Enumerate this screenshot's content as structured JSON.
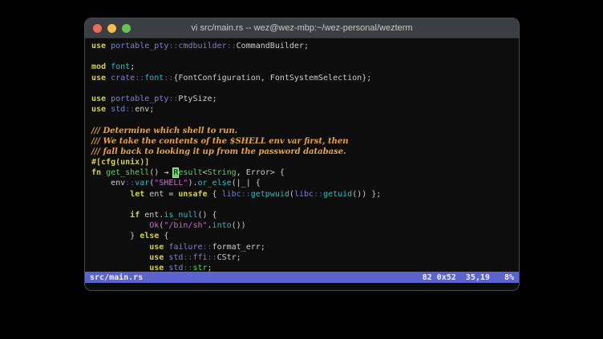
{
  "window": {
    "title": "vi src/main.rs -- wez@wez-mbp:~/wez-personal/wezterm",
    "traffic_lights": [
      "close",
      "minimize",
      "zoom"
    ]
  },
  "palette": {
    "terminal_background": "#0d0d0d",
    "titlebar_background": "#3b3e43",
    "keyword_yellow": "#d1d14f",
    "module_blue": "#7f7fd4",
    "separator_blue": "#5151b8",
    "function_cyan": "#2ebdbd",
    "type_green": "#57d657",
    "string_magenta": "#d863d8",
    "comment_orange": "#e9a33d",
    "plain_text": "#cdcdcd",
    "statusline_background": "#5b63cf",
    "cursor_green": "#5fd75f",
    "light_red": "#ec6a5e",
    "light_yellow": "#f5bd4f",
    "light_green": "#61c454"
  },
  "editor": {
    "lines": [
      [
        [
          "kw",
          "use "
        ],
        [
          "mod",
          "portable_pty"
        ],
        [
          "pun",
          "::"
        ],
        [
          "mod",
          "cmdbuilder"
        ],
        [
          "pun",
          "::"
        ],
        [
          "txt",
          "CommandBuilder;"
        ]
      ],
      [],
      [
        [
          "kw",
          "mod "
        ],
        [
          "fnc",
          "font"
        ],
        [
          "txt",
          ";"
        ]
      ],
      [
        [
          "kw",
          "use "
        ],
        [
          "mod",
          "crate"
        ],
        [
          "pun",
          "::"
        ],
        [
          "fnc",
          "font"
        ],
        [
          "pun",
          "::"
        ],
        [
          "txt",
          "{FontConfiguration, FontSystemSelection};"
        ]
      ],
      [],
      [
        [
          "kw",
          "use "
        ],
        [
          "mod",
          "portable_pty"
        ],
        [
          "pun",
          "::"
        ],
        [
          "txt",
          "PtySize;"
        ]
      ],
      [
        [
          "kw",
          "use "
        ],
        [
          "mod",
          "std"
        ],
        [
          "pun",
          "::"
        ],
        [
          "txt",
          "env;"
        ]
      ],
      [],
      [
        [
          "cmt",
          "/// Determine which shell to run."
        ]
      ],
      [
        [
          "cmt",
          "/// We take the contents of the $SHELL env var first, then"
        ]
      ],
      [
        [
          "cmt",
          "/// fall back to looking it up from the password database."
        ]
      ],
      [
        [
          "kw",
          "#[cfg(unix)]"
        ]
      ],
      [
        [
          "kw",
          "fn "
        ],
        [
          "typ",
          "get_shell"
        ],
        [
          "txt",
          "() "
        ],
        [
          "kw",
          "→ "
        ],
        [
          "cur",
          "R"
        ],
        [
          "typ",
          "esult"
        ],
        [
          "txt",
          "<"
        ],
        [
          "typ",
          "String"
        ],
        [
          "txt",
          ", Error> {"
        ]
      ],
      [
        [
          "txt",
          "    env"
        ],
        [
          "pun",
          "::"
        ],
        [
          "fnc",
          "var"
        ],
        [
          "txt",
          "("
        ],
        [
          "str",
          "\"SHELL\""
        ],
        [
          "txt",
          ")."
        ],
        [
          "fnc",
          "or_else"
        ],
        [
          "txt",
          "(|_| {"
        ]
      ],
      [
        [
          "txt",
          "        "
        ],
        [
          "kw",
          "let "
        ],
        [
          "txt",
          "ent = "
        ],
        [
          "kw",
          "unsafe "
        ],
        [
          "txt",
          "{ "
        ],
        [
          "mod",
          "libc"
        ],
        [
          "pun",
          "::"
        ],
        [
          "fnc",
          "getpwuid"
        ],
        [
          "txt",
          "("
        ],
        [
          "mod",
          "libc"
        ],
        [
          "pun",
          "::"
        ],
        [
          "fnc",
          "getuid"
        ],
        [
          "txt",
          "()) };"
        ]
      ],
      [],
      [
        [
          "txt",
          "        "
        ],
        [
          "kw",
          "if "
        ],
        [
          "txt",
          "ent."
        ],
        [
          "fnc",
          "is_null"
        ],
        [
          "txt",
          "() {"
        ]
      ],
      [
        [
          "txt",
          "            "
        ],
        [
          "str",
          "Ok"
        ],
        [
          "txt",
          "("
        ],
        [
          "str",
          "\"/bin/sh\""
        ],
        [
          "txt",
          "."
        ],
        [
          "fnc",
          "into"
        ],
        [
          "txt",
          "())"
        ]
      ],
      [
        [
          "txt",
          "        } "
        ],
        [
          "kw",
          "else "
        ],
        [
          "txt",
          "{"
        ]
      ],
      [
        [
          "txt",
          "            "
        ],
        [
          "kw",
          "use "
        ],
        [
          "mod",
          "failure"
        ],
        [
          "pun",
          "::"
        ],
        [
          "txt",
          "format_err;"
        ]
      ],
      [
        [
          "txt",
          "            "
        ],
        [
          "kw",
          "use "
        ],
        [
          "mod",
          "std"
        ],
        [
          "pun",
          "::"
        ],
        [
          "mod",
          "ffi"
        ],
        [
          "pun",
          "::"
        ],
        [
          "txt",
          "CStr;"
        ]
      ],
      [
        [
          "txt",
          "            "
        ],
        [
          "kw",
          "use "
        ],
        [
          "mod",
          "std"
        ],
        [
          "pun",
          "::"
        ],
        [
          "typ",
          "str"
        ],
        [
          "txt",
          ";"
        ]
      ]
    ],
    "statusline": {
      "file": "src/main.rs",
      "right": "82 0x52  35,19   8%"
    }
  }
}
